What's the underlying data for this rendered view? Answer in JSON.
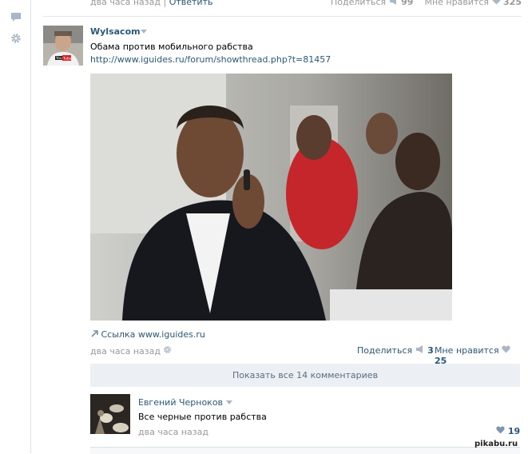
{
  "top_row": {
    "time": "два часа назад",
    "separator": "|",
    "reply_label": "Ответить",
    "share_label": "Поделиться",
    "share_count": "99",
    "like_label": "Мне нравится",
    "like_count": "325"
  },
  "post": {
    "author": "Wylsacom",
    "text": "Обама против мобильного рабства",
    "url": "http://www.iguides.ru/forum/showthread.php?t=81457",
    "attachment_label": "Ссылка www.iguides.ru",
    "time": "два часа назад",
    "share_label": "Поделиться",
    "share_count": "3",
    "like_label": "Мне нравится",
    "like_count": "25",
    "avatar_logo_text": "You Tube"
  },
  "comments": {
    "show_all_label": "Показать все 14 комментариев",
    "items": [
      {
        "author": "Евгений Черноков",
        "text": "Все черные против рабства",
        "time": "два часа назад",
        "like_count": "19"
      }
    ]
  },
  "watermark": "pikabu.ru",
  "icons": {
    "rail": [
      "speech-bubble-icon",
      "gear-icon"
    ],
    "share": "megaphone-icon",
    "like": "heart-icon",
    "settings": "gear-icon",
    "attachment": "arrow-link-icon",
    "dropdown": "triangle-down-icon"
  },
  "colors": {
    "link": "#2b587a",
    "meta_text": "#999999",
    "panel_bg": "#eceff3",
    "heart": "#aab7c7"
  }
}
